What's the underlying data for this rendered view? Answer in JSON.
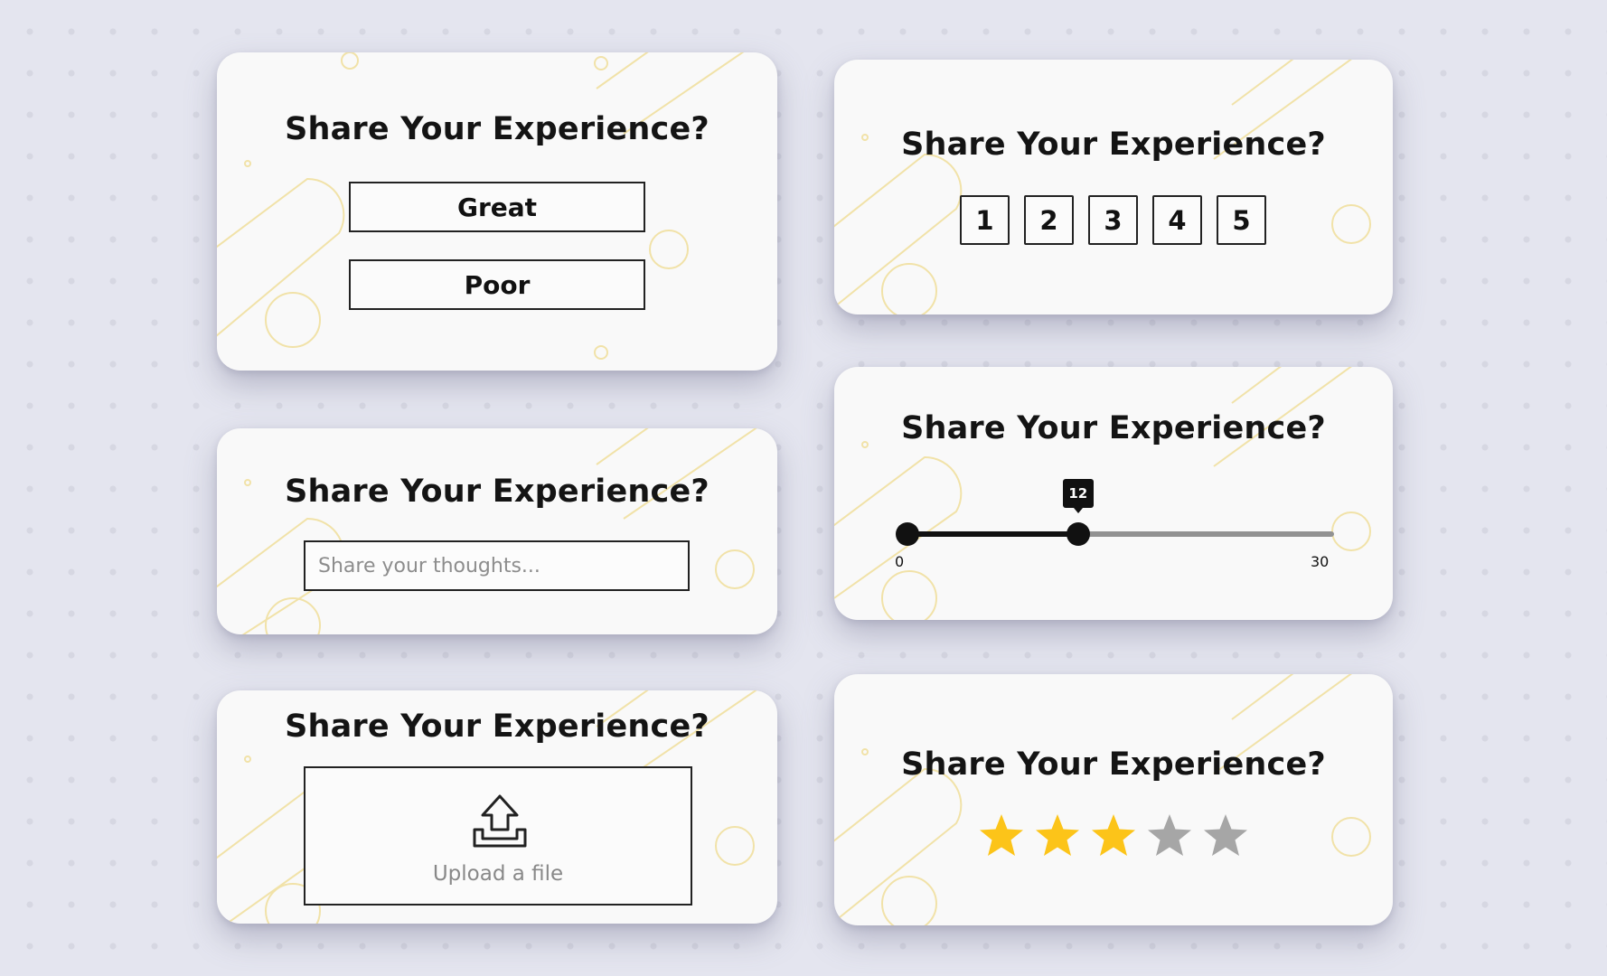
{
  "cards": {
    "choice": {
      "title": "Share Your Experience?",
      "options": [
        "Great",
        "Poor"
      ]
    },
    "number_rating": {
      "title": "Share Your Experience?",
      "numbers": [
        "1",
        "2",
        "3",
        "4",
        "5"
      ]
    },
    "text_feedback": {
      "title": "Share Your Experience?",
      "placeholder": "Share your thoughts..."
    },
    "slider": {
      "title": "Share Your Experience?",
      "min_label": "0",
      "max_label": "30",
      "value_label": "12",
      "min": 0,
      "max": 30,
      "value": 12
    },
    "upload": {
      "title": "Share Your Experience?",
      "label": "Upload a file",
      "icon": "upload-icon"
    },
    "stars": {
      "title": "Share Your Experience?",
      "rating": 3,
      "max": 5
    }
  },
  "colors": {
    "background": "#e4e5ef",
    "card": "#f9f9f9",
    "decoration": "#f1e2a8",
    "star_filled": "#fcc419",
    "star_empty": "#a6a6a6",
    "slider_fill": "#111111",
    "slider_track": "#929292"
  }
}
